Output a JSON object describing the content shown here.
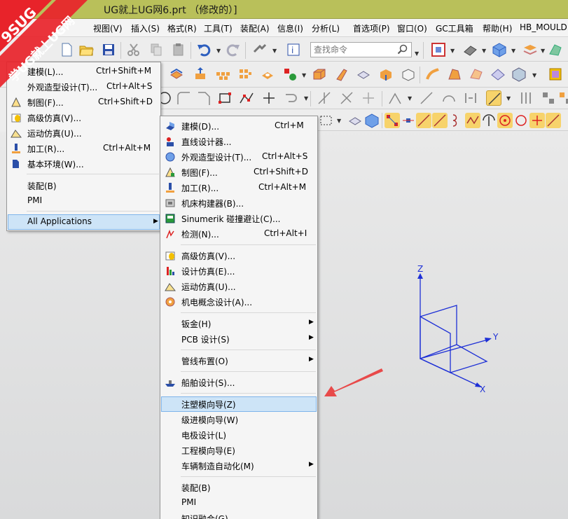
{
  "title_bar": {
    "text": "UG就上UG网6.prt （修改的）]"
  },
  "watermark": {
    "line1": "9SUG",
    "line2": "学UG就上UG网"
  },
  "menu_bar": {
    "items": [
      "视图(V)",
      "插入(S)",
      "格式(R)",
      "工具(T)",
      "装配(A)",
      "信息(I)",
      "分析(L)",
      "首选项(P)",
      "窗口(O)",
      "GC工具箱",
      "帮助(H)",
      "HB_MOULD"
    ]
  },
  "search": {
    "placeholder": "查找命令"
  },
  "start_menu": {
    "items": [
      {
        "label": "建模(L)...",
        "accel": "Ctrl+Shift+M"
      },
      {
        "label": "外观造型设计(T)...",
        "accel": "Ctrl+Alt+S"
      },
      {
        "label": "制图(F)...",
        "accel": "Ctrl+Shift+D"
      },
      {
        "label": "高级仿真(V)...",
        "accel": ""
      },
      {
        "label": "运动仿真(U)...",
        "accel": ""
      },
      {
        "label": "加工(R)...",
        "accel": "Ctrl+Alt+M"
      },
      {
        "label": "基本环境(W)...",
        "accel": ""
      },
      {
        "label": "装配(B)",
        "accel": ""
      },
      {
        "label": "PMI",
        "accel": ""
      },
      {
        "label": "All Applications",
        "accel": ""
      }
    ]
  },
  "all_apps_menu": {
    "items": [
      {
        "label": "建模(D)...",
        "accel": "Ctrl+M"
      },
      {
        "label": "直线设计器...",
        "accel": ""
      },
      {
        "label": "外观造型设计(T)...",
        "accel": "Ctrl+Alt+S"
      },
      {
        "label": "制图(F)...",
        "accel": "Ctrl+Shift+D"
      },
      {
        "label": "加工(R)...",
        "accel": "Ctrl+Alt+M"
      },
      {
        "label": "机床构建器(B)...",
        "accel": ""
      },
      {
        "label": "Sinumerik 碰撞避让(C)...",
        "accel": ""
      },
      {
        "label": "检测(N)...",
        "accel": "Ctrl+Alt+I"
      },
      {
        "label": "高级仿真(V)...",
        "accel": ""
      },
      {
        "label": "设计仿真(E)...",
        "accel": ""
      },
      {
        "label": "运动仿真(U)...",
        "accel": ""
      },
      {
        "label": "机电概念设计(A)...",
        "accel": ""
      },
      {
        "label": "钣金(H)",
        "accel": ""
      },
      {
        "label": "PCB 设计(S)",
        "accel": ""
      },
      {
        "label": "管线布置(O)",
        "accel": ""
      },
      {
        "label": "船舶设计(S)...",
        "accel": ""
      },
      {
        "label": "注塑模向导(Z)",
        "accel": ""
      },
      {
        "label": "级进模向导(W)",
        "accel": ""
      },
      {
        "label": "电极设计(L)",
        "accel": ""
      },
      {
        "label": "工程模向导(E)",
        "accel": ""
      },
      {
        "label": "车辆制造自动化(M)",
        "accel": ""
      },
      {
        "label": "装配(B)",
        "accel": ""
      },
      {
        "label": "PMI",
        "accel": ""
      },
      {
        "label": "知识融合(G)",
        "accel": ""
      }
    ]
  },
  "axes": {
    "z": "Z",
    "y": "Y",
    "x": "X"
  },
  "colors": {
    "title_bar": "#b9c05a",
    "highlight": "#cde4f7",
    "axis_blue": "#1d2fd6",
    "arrow_red": "#e84a4a",
    "watermark_red": "#e8232a"
  }
}
